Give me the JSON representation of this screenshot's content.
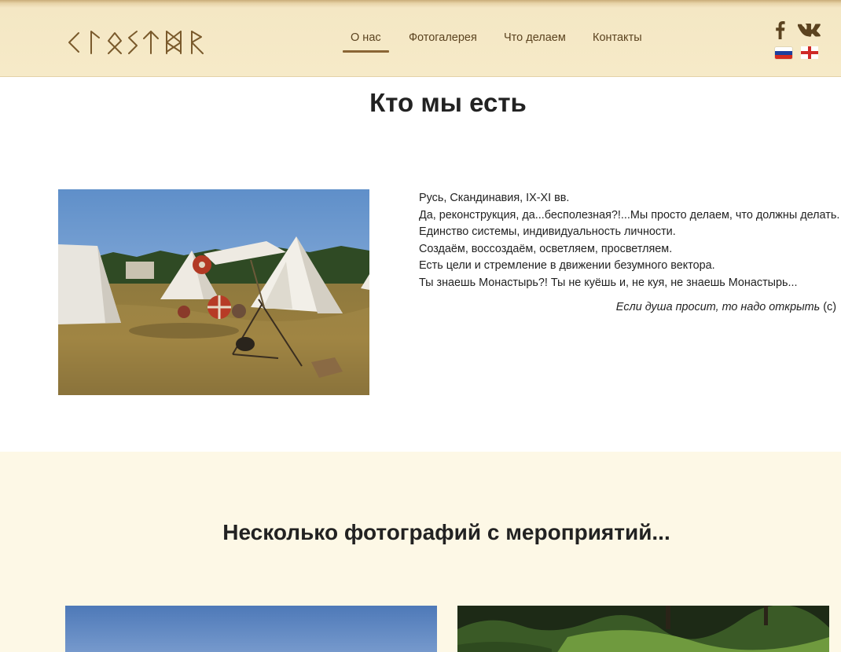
{
  "header": {
    "logo_alt": "Runic logo",
    "nav": [
      {
        "label": "О нас",
        "active": true
      },
      {
        "label": "Фотогалерея",
        "active": false
      },
      {
        "label": "Что делаем",
        "active": false
      },
      {
        "label": "Контакты",
        "active": false
      }
    ],
    "social": {
      "facebook_icon": "facebook-icon",
      "vk_icon": "vk-icon"
    },
    "languages": [
      "ru-flag-icon",
      "en-flag-icon"
    ]
  },
  "about": {
    "title": "Кто мы есть",
    "lines": [
      "Русь, Скандинавия, IX-XI вв.",
      "Да, реконструкция, да...бесполезная?!...Мы просто делаем, что должны делать.",
      "Единство системы, индивидуальность личности.",
      "Создаём, воссоздаём, осветляем, просветляем.",
      "Есть цели и стремление в движении безумного вектора.",
      "Ты знаешь Монастырь?! Ты не куёшь и, не куя, не знаешь Монастырь..."
    ],
    "quote_italic": "Если душа просит, то надо открыть",
    "quote_suffix": " (c)"
  },
  "gallery": {
    "title": "Несколько фотографий с мероприятий..."
  },
  "colors": {
    "header_bg": "#f6eac8",
    "nav_text": "#5b4320",
    "accent": "#8a6535",
    "gallery_bg": "#fdf8e6"
  }
}
